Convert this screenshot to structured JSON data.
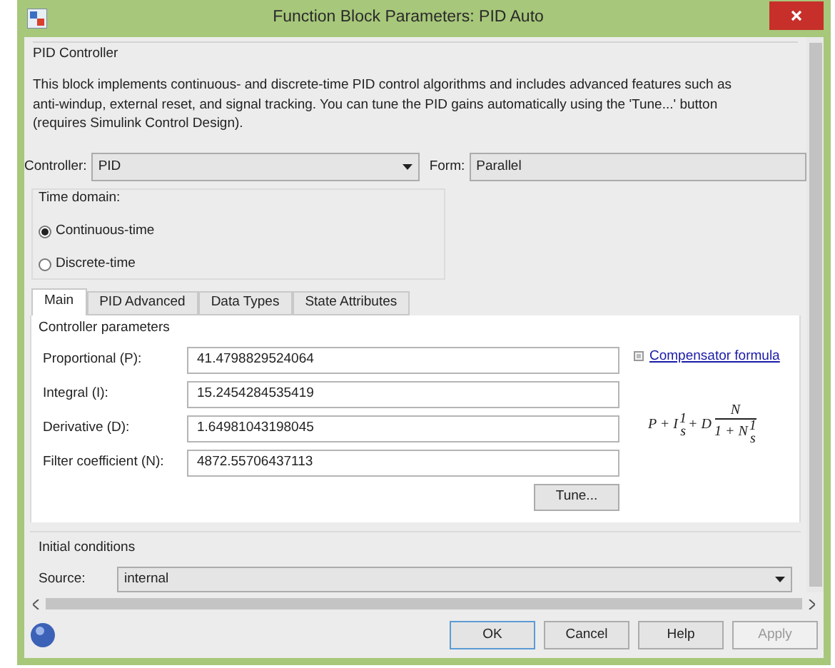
{
  "window": {
    "title": "Function Block Parameters: PID Auto"
  },
  "block": {
    "name": "PID Controller",
    "description": [
      "This block implements continuous- and discrete-time PID control algorithms and includes advanced features such as",
      "anti-windup, external reset, and signal tracking. You can tune the PID gains automatically using the 'Tune...' button",
      "(requires Simulink Control Design)."
    ]
  },
  "controller": {
    "label": "Controller:",
    "value": "PID"
  },
  "form": {
    "label": "Form:",
    "value": "Parallel"
  },
  "time_domain": {
    "title": "Time domain:",
    "options": [
      {
        "label": "Continuous-time",
        "selected": true
      },
      {
        "label": "Discrete-time",
        "selected": false
      }
    ]
  },
  "tabs": [
    {
      "label": "Main",
      "selected": true
    },
    {
      "label": "PID Advanced",
      "selected": false
    },
    {
      "label": "Data Types",
      "selected": false
    },
    {
      "label": "State Attributes",
      "selected": false
    }
  ],
  "controller_parameters": {
    "title": "Controller parameters",
    "fields": [
      {
        "label": "Proportional (P):",
        "value": "41.4798829524064"
      },
      {
        "label": "Integral (I):",
        "value": "15.2454284535419"
      },
      {
        "label": "Derivative (D):",
        "value": "1.64981043198045"
      },
      {
        "label": "Filter coefficient (N):",
        "value": "4872.55706437113"
      }
    ],
    "tune_button": "Tune...",
    "link": "Compensator formula",
    "expanded": false,
    "formula": {
      "lead": "P + I",
      "num1": "1",
      "den1": "s",
      "mid": "+ D",
      "num2": "N",
      "den2_lead": "1 + N",
      "num3": "1",
      "den3": "s"
    }
  },
  "initial_conditions": {
    "title": "Initial conditions",
    "source": {
      "label": "Source:",
      "value": "internal"
    }
  },
  "buttons": [
    {
      "label": "OK",
      "disabled": false,
      "default": true
    },
    {
      "label": "Cancel",
      "disabled": false,
      "default": false
    },
    {
      "label": "Help",
      "disabled": false,
      "default": false
    },
    {
      "label": "Apply",
      "disabled": true,
      "default": false
    }
  ]
}
